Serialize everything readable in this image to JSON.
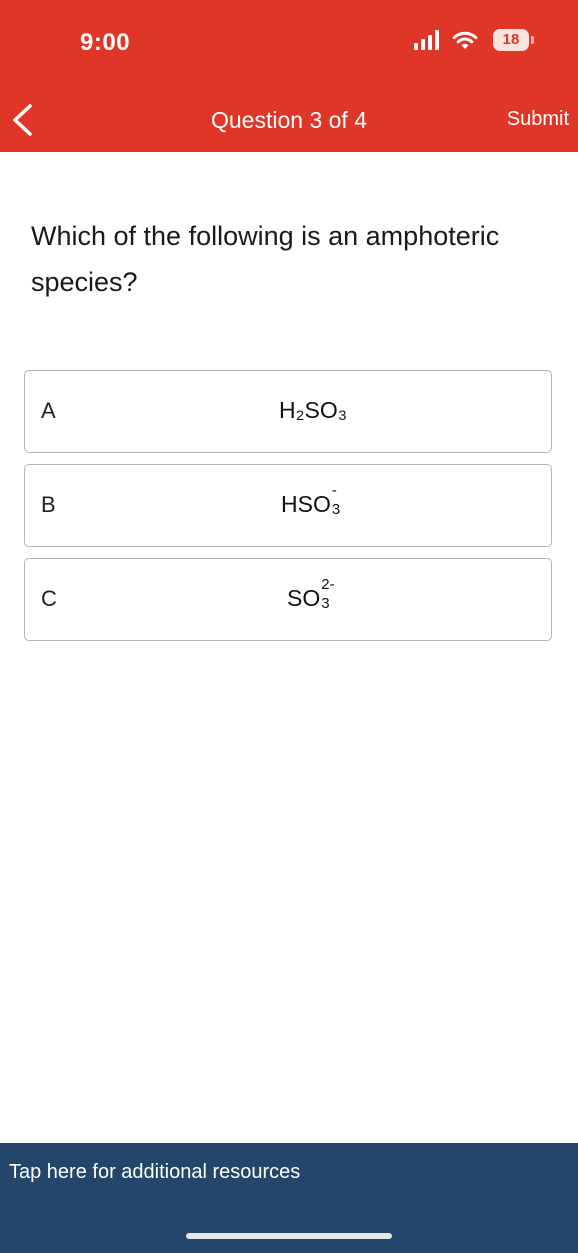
{
  "status_bar": {
    "time": "9:00",
    "battery_level": "18",
    "icons": [
      "signal-bars-icon",
      "wifi-icon",
      "battery-icon"
    ]
  },
  "nav": {
    "back_icon": "chevron-left-icon",
    "title": "Question 3 of 4",
    "submit_label": "Submit"
  },
  "question": {
    "text": "Which of the following is an amphoteric species?"
  },
  "options": [
    {
      "letter": "A",
      "formula": "H₂SO₃"
    },
    {
      "letter": "B",
      "formula_base": "HSO",
      "formula_subscript": "3",
      "formula_superscript": "-"
    },
    {
      "letter": "C",
      "formula_base": "SO",
      "formula_subscript": "3",
      "formula_superscript": "2-"
    }
  ],
  "footer": {
    "resources_label": "Tap here for additional resources"
  },
  "colors": {
    "header_bg": "#e03628",
    "footer_bg": "#24466a",
    "option_border": "#b5b5b5"
  }
}
